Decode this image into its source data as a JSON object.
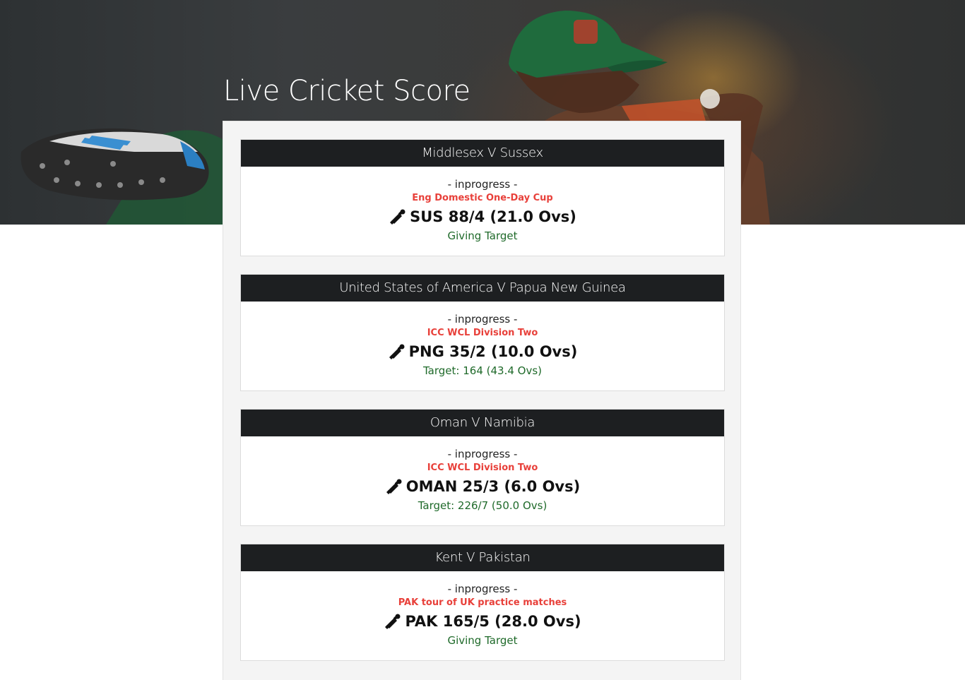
{
  "page": {
    "title": "Live Cricket Score"
  },
  "colors": {
    "header_bg": "#1d1f21",
    "series_red": "#e8403a",
    "target_green": "#1f6a2a",
    "panel_bg": "#f4f4f4"
  },
  "matches": [
    {
      "title": "Middlesex V Sussex",
      "status": "- inprogress -",
      "series": "Eng Domestic One-Day Cup",
      "score": "SUS 88/4 (21.0 Ovs)",
      "target": "Giving Target",
      "icon": "cricket-bat-icon"
    },
    {
      "title": "United States of America V Papua New Guinea",
      "status": "- inprogress -",
      "series": "ICC WCL Division Two",
      "score": "PNG 35/2 (10.0 Ovs)",
      "target": "Target: 164 (43.4 Ovs)",
      "icon": "cricket-bat-icon"
    },
    {
      "title": "Oman V Namibia",
      "status": "- inprogress -",
      "series": "ICC WCL Division Two",
      "score": "OMAN 25/3 (6.0 Ovs)",
      "target": "Target: 226/7 (50.0 Ovs)",
      "icon": "cricket-bat-icon"
    },
    {
      "title": "Kent V Pakistan",
      "status": "- inprogress -",
      "series": "PAK tour of UK practice matches",
      "score": "PAK 165/5 (28.0 Ovs)",
      "target": "Giving Target",
      "icon": "cricket-bat-icon"
    }
  ]
}
